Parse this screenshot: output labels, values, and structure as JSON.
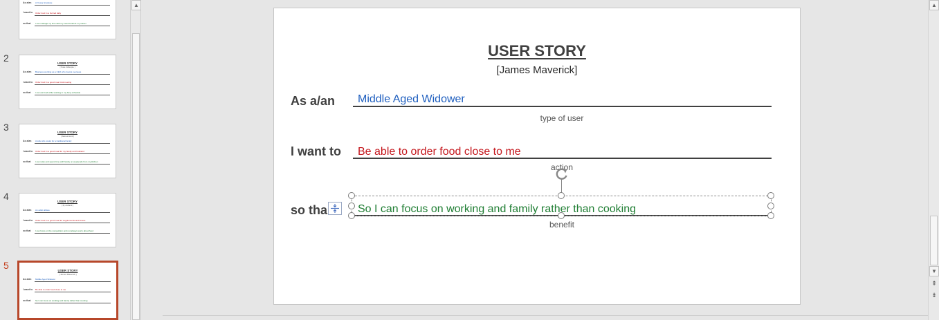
{
  "thumbnails": {
    "top_partial": {
      "line1": "A Young Graduate",
      "line2": "Order food in a hurried daily",
      "line3": "I can manage my time with my new friends & my career"
    },
    "labels": {
      "as": "As a/an",
      "want": "I want to",
      "so": "so that"
    },
    "slides": [
      {
        "number": "2",
        "title": "USER STORY",
        "name": "[ Kate Gillespie ]",
        "v1": "Business working as a CEO who travels overseas",
        "v2": "Order food in a good meal mid-meeting",
        "v3": "I can eat food while working in my busy schedule"
      },
      {
        "number": "3",
        "title": "USER STORY",
        "name": "[ James Hunt ]",
        "v1": "A wife who cooks for a traditional family",
        "v2": "Order food in a good meal for my family and husband",
        "v3": "I can relax and spend time with family on weekends from my kitchen"
      },
      {
        "number": "4",
        "title": "USER STORY",
        "name": "[ Ily Ashanti ]",
        "v1": "An adult athlete",
        "v2": "Order food in a good meal for supplements and fitness",
        "v3": "I can focus on the competition and not always worry about food"
      },
      {
        "number": "5",
        "title": "USER STORY",
        "name": "[ James Maverick ]",
        "v1": "Middle Aged Widower",
        "v2": "Be able to order food close to me",
        "v3": "So I can focus on working and family rather than cooking"
      }
    ]
  },
  "slide": {
    "title": "USER STORY",
    "subtitle": "[James Maverick]",
    "label_as": "As a/an",
    "label_want": "I want to",
    "label_so": "so tha",
    "value_user": "Middle Aged Widower",
    "value_action": "Be able to order food close to me",
    "value_benefit": "So I can focus on working and family rather than cooking",
    "caption_user": "type of user",
    "caption_action": "action",
    "caption_benefit": "benefit"
  },
  "colors": {
    "user": "#1f5fbf",
    "action": "#c4161c",
    "benefit": "#1e7d32",
    "active_thumb": "#b7472a"
  },
  "icons": {
    "scroll_up": "▲",
    "scroll_down": "▼",
    "prev_slide": "⇞",
    "next_slide": "⇟"
  }
}
